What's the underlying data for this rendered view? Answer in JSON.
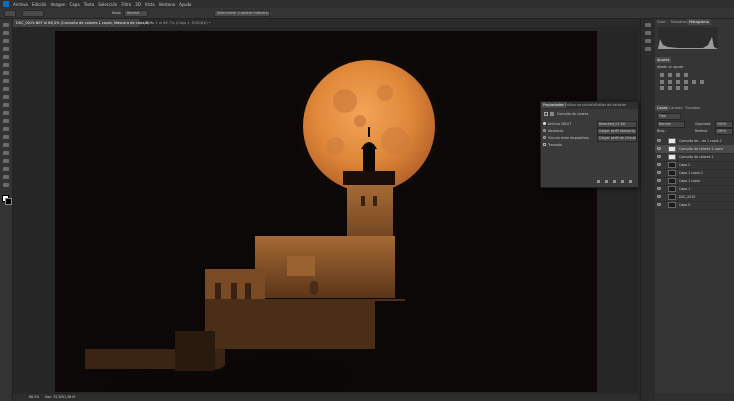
{
  "menubar": {
    "items": [
      "Archivo",
      "Edición",
      "Imagen",
      "Capa",
      "Texto",
      "Selección",
      "Filtro",
      "3D",
      "Vista",
      "Ventana",
      "Ayuda"
    ]
  },
  "options": {
    "mode_label": "Modo",
    "mode_value": "Normal",
    "select_mask_button": "Seleccionar y aplicar máscara..."
  },
  "tabs": [
    {
      "label": "DSC_0015.NEF al 66,3% (Consulta de colores 1 copia, Máscara de capa/8) *",
      "active": true
    },
    {
      "label": "Sin título-1 al 66,7% (Capa 1, RGB/8#) *",
      "active": false
    }
  ],
  "status": {
    "zoom": "66,3%",
    "doc": "Doc: 35,2M/1,46 M"
  },
  "right_panel": {
    "top_tabs": [
      "Color",
      "Muestras",
      "Histograma"
    ],
    "adjust_tabs": [
      "Ajustes"
    ],
    "adjust_hint": "Añadir un ajuste",
    "layer_tabs": [
      "Capas",
      "Canales",
      "Trazados"
    ],
    "kind_label": "Tipo",
    "blend_mode": "Normal",
    "opacity_label": "Opacidad:",
    "opacity_value": "100%",
    "lock_label": "Bloq.:",
    "fill_label": "Relleno:",
    "fill_value": "100%",
    "layers": [
      {
        "name": "Consulta de... de 1 copia 2",
        "thumb": "white"
      },
      {
        "name": "Consulta de colores 1 copia",
        "thumb": "white"
      },
      {
        "name": "Consulta de colores 1",
        "thumb": "white"
      },
      {
        "name": "Capa 2",
        "thumb": "dark"
      },
      {
        "name": "Capa 1 copia 2",
        "thumb": "dark"
      },
      {
        "name": "Capa 1 copia",
        "thumb": "dark"
      },
      {
        "name": "Capa 1",
        "thumb": "dark"
      },
      {
        "name": "DSC_0015",
        "thumb": "dark"
      },
      {
        "name": "Capa 0",
        "thumb": "dark"
      }
    ]
  },
  "properties": {
    "tabs": [
      "Propiedades",
      "Estilos de párrafo",
      "Estilos de carácter"
    ],
    "title": "Consulta de colores",
    "archivo_label": "Archivo 3DLUT",
    "archivo_value": "Bleached_01.3dl",
    "abstracto_label": "Abstracto",
    "abstracto_value": "Cargar perfil abstracto...",
    "vinculo_label": "Vínculo entre dispositivos",
    "vinculo_value": "Cargar perfil de vínculo...",
    "tramado_label": "Tramado"
  },
  "colors": {
    "moon": "#e0883a",
    "sky": "#0b0807",
    "building": "#8a5a2e",
    "ui_bg": "#282828"
  }
}
